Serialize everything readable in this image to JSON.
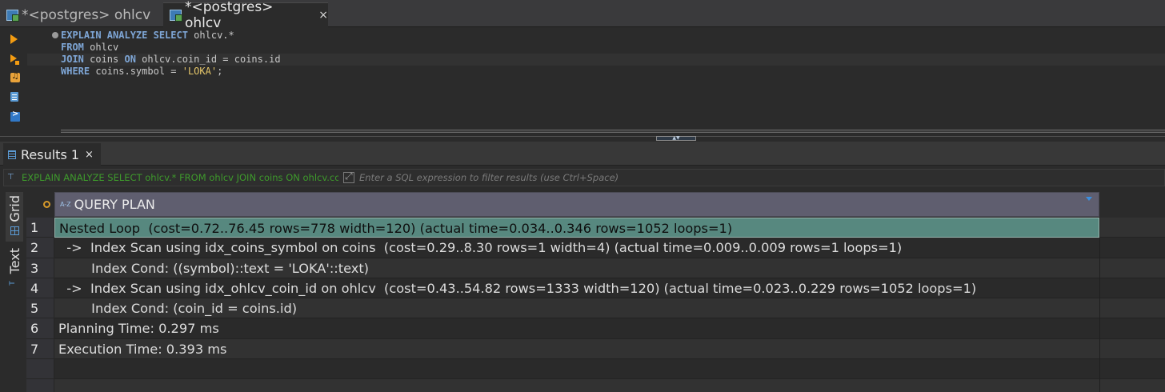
{
  "editor_tabs": [
    {
      "label": "*<postgres> ohlcv",
      "active": false
    },
    {
      "label": "*<postgres> ohlcv",
      "active": true,
      "close": "×"
    }
  ],
  "gutter_icons": [
    "run-statement-icon",
    "run-script-icon",
    "explain-plan-icon",
    "load-script-icon",
    "open-console-icon"
  ],
  "sql": {
    "line1_kw": "EXPLAIN ANALYZE SELECT",
    "line1_rest": " ohlcv.*",
    "line2_kw": "FROM",
    "line2_rest": " ohlcv",
    "line3_kw1": "JOIN",
    "line3_mid": " coins ",
    "line3_kw2": "ON",
    "line3_rest": " ohlcv.coin_id = coins.id",
    "line4_kw": "WHERE",
    "line4_mid": " coins.symbol = ",
    "line4_str": "'LOKA'",
    "line4_end": ";"
  },
  "results": {
    "tab_label": "Results 1",
    "tab_close": "×",
    "filter_query": "EXPLAIN ANALYZE SELECT ohlcv.* FROM ohlcv JOIN coins ON ohlcv.coin_id",
    "filter_placeholder": "Enter a SQL expression to filter results (use Ctrl+Space)",
    "side_tabs": [
      "Grid",
      "Text"
    ],
    "column": {
      "type_badge": "A-Z",
      "name": "QUERY PLAN"
    },
    "rows": [
      {
        "n": "1",
        "text": "Nested Loop  (cost=0.72..76.45 rows=778 width=120) (actual time=0.034..0.346 rows=1052 loops=1)"
      },
      {
        "n": "2",
        "text": "  ->  Index Scan using idx_coins_symbol on coins  (cost=0.29..8.30 rows=1 width=4) (actual time=0.009..0.009 rows=1 loops=1)"
      },
      {
        "n": "3",
        "text": "        Index Cond: ((symbol)::text = 'LOKA'::text)"
      },
      {
        "n": "4",
        "text": "  ->  Index Scan using idx_ohlcv_coin_id on ohlcv  (cost=0.43..54.82 rows=1333 width=120) (actual time=0.023..0.229 rows=1052 loops=1)"
      },
      {
        "n": "5",
        "text": "        Index Cond: (coin_id = coins.id)"
      },
      {
        "n": "6",
        "text": "Planning Time: 0.297 ms"
      },
      {
        "n": "7",
        "text": "Execution Time: 0.393 ms"
      }
    ]
  },
  "colors": {
    "selection": "#57887f",
    "header": "#5f5e6f",
    "keyword": "#7ea6d6",
    "string": "#e6c76a",
    "filter_text": "#3e9a2c"
  }
}
